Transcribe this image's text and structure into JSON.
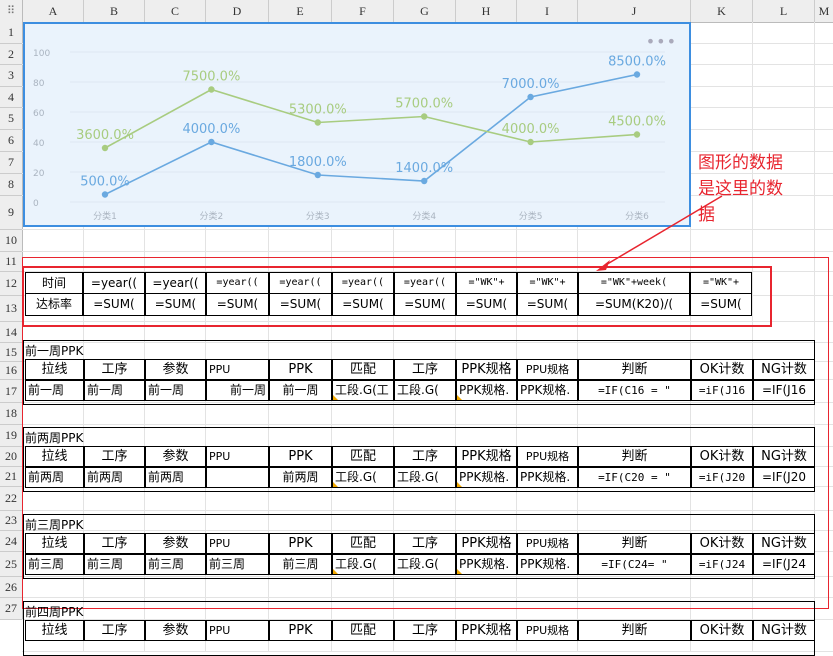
{
  "columns": [
    "A",
    "B",
    "C",
    "D",
    "E",
    "F",
    "G",
    "H",
    "I",
    "J",
    "K",
    "L",
    "M"
  ],
  "rows": [
    "1",
    "2",
    "3",
    "4",
    "5",
    "6",
    "7",
    "8",
    "9",
    "10",
    "11",
    "12",
    "13",
    "14",
    "15",
    "16",
    "17",
    "18",
    "19",
    "20",
    "21",
    "22",
    "23",
    "24",
    "25",
    "26",
    "27"
  ],
  "chart_data": {
    "type": "line",
    "categories": [
      "分类1",
      "分类2",
      "分类3",
      "分类4",
      "分类5",
      "分类6"
    ],
    "yticks": [
      "0",
      "20",
      "40",
      "60",
      "80",
      "100"
    ],
    "ylim": [
      0,
      100
    ],
    "series": [
      {
        "values": [
          5.0,
          40.0,
          18.0,
          14.0,
          70.0,
          85.0
        ],
        "labels": [
          "500.0%",
          "4000.0%",
          "1800.0%",
          "1400.0%",
          "7000.0%",
          "8500.0%"
        ],
        "color": "#6aa9e0"
      },
      {
        "values": [
          36.0,
          75.0,
          53.0,
          57.0,
          40.0,
          45.0
        ],
        "labels": [
          "3600.0%",
          "7500.0%",
          "5300.0%",
          "5700.0%",
          "4000.0%",
          "4500.0%"
        ],
        "color": "#a8cc80"
      }
    ]
  },
  "annotation": {
    "line1": "图形的数据",
    "line2": "是这里的数",
    "line3": "据"
  },
  "summary": {
    "row1_label": "时间",
    "row1": [
      "=year((",
      "=year((",
      "=year((",
      "=year((",
      "=year((",
      "=year((",
      "=\"WK\"+",
      "=\"WK\"+",
      "=\"WK\"+week(",
      "=\"WK\"+"
    ],
    "row2_label": "达标率",
    "row2": [
      "=SUM(",
      "=SUM(",
      "=SUM(",
      "=SUM(",
      "=SUM(",
      "=SUM(",
      "=SUM(",
      "=SUM(",
      "=SUM(K20)/(",
      "=SUM("
    ]
  },
  "sections": [
    {
      "title": "前一周PPK",
      "headers": [
        "拉线",
        "工序",
        "参数",
        "PPU",
        "PPK",
        "匹配",
        "工序",
        "PPK规格",
        "PPU规格",
        "判断",
        "OK计数",
        "NG计数"
      ],
      "data": [
        "前一周",
        "前一周",
        "前一周",
        "前一周",
        "前一周",
        "工段.G(工",
        "工段.G(",
        "PPK规格.",
        "PPK规格.",
        "=IF(C16 = \"",
        "=iF(J16",
        "=IF(J16"
      ]
    },
    {
      "title": "前两周PPK",
      "headers": [
        "拉线",
        "工序",
        "参数",
        "PPU",
        "PPK",
        "匹配",
        "工序",
        "PPK规格",
        "PPU规格",
        "判断",
        "OK计数",
        "NG计数"
      ],
      "data": [
        "前两周",
        "前两周",
        "前两周",
        "",
        "前两周",
        "工段.G(",
        "工段.G(",
        "PPK规格.",
        "PPK规格.",
        "=IF(C20 = \"",
        "=iF(J20",
        "=IF(J20"
      ]
    },
    {
      "title": "前三周PPK",
      "headers": [
        "拉线",
        "工序",
        "参数",
        "PPU",
        "PPK",
        "匹配",
        "工序",
        "PPK规格",
        "PPU规格",
        "判断",
        "OK计数",
        "NG计数"
      ],
      "data": [
        "前三周",
        "前三周",
        "前三周",
        "前三周",
        "前三周",
        "工段.G(",
        "工段.G(",
        "PPK规格.",
        "PPK规格.",
        "=IF(C24= \"",
        "=iF(J24",
        "=IF(J24"
      ]
    },
    {
      "title": "前四周PPK",
      "headers": [
        "拉线",
        "工序",
        "参数",
        "PPU",
        "PPK",
        "匹配",
        "工序",
        "PPK规格",
        "PPU规格",
        "判断",
        "OK计数",
        "NG计数"
      ],
      "data": []
    }
  ]
}
